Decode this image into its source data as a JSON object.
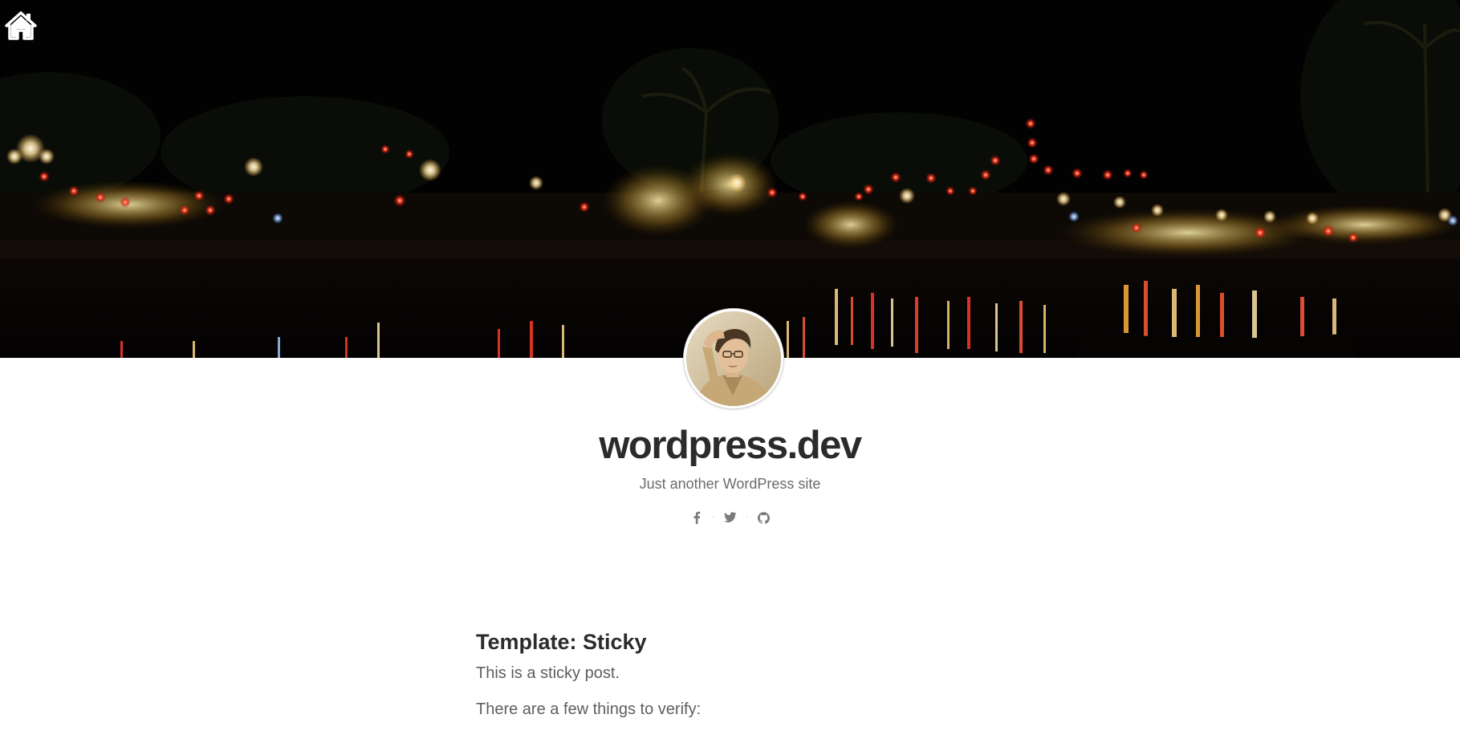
{
  "nav": {
    "home_icon": "home-icon"
  },
  "header": {
    "banner_image": "night river market with lanterns",
    "avatar_image": "author portrait",
    "site_title": "wordpress.dev",
    "site_description": "Just another WordPress site",
    "social": [
      {
        "name": "facebook",
        "icon": "facebook-icon"
      },
      {
        "name": "twitter",
        "icon": "twitter-icon"
      },
      {
        "name": "github",
        "icon": "github-icon"
      }
    ],
    "social_separator": "·"
  },
  "post": {
    "title": "Template: Sticky",
    "paragraphs": [
      "This is a sticky post.",
      "There are a few things to verify:"
    ]
  },
  "colors": {
    "title": "#2b2b2b",
    "body_text": "#5e5e5e",
    "muted_text": "#6b6b6b",
    "icon": "#7a7a7a",
    "hero_bg": "#020202"
  }
}
